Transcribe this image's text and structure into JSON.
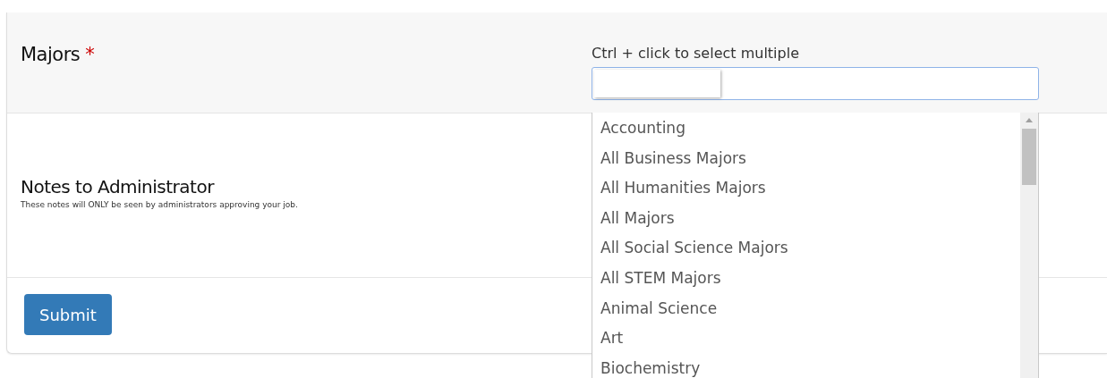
{
  "majors": {
    "label": "Majors",
    "required_mark": "*",
    "hint": "Ctrl + click to select multiple",
    "options": [
      "Accounting",
      "All Business Majors",
      "All Humanities Majors",
      "All Majors",
      "All Social Science Majors",
      "All STEM Majors",
      "Animal Science",
      "Art",
      "Biochemistry"
    ]
  },
  "notes": {
    "label": "Notes to Administrator",
    "help": "These notes will ONLY be seen by administrators approving your job."
  },
  "submit": "Submit"
}
